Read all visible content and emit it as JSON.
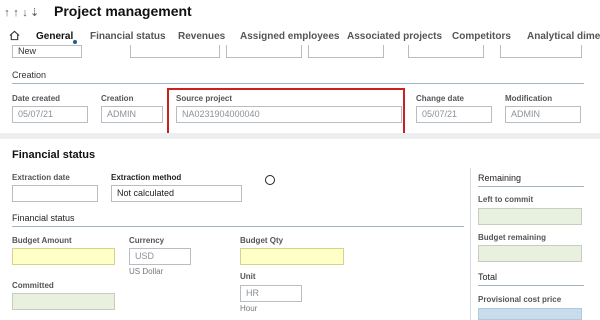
{
  "header": {
    "title": "Project management",
    "nav_arrows": [
      "↑",
      "↑",
      "↓",
      "⇣"
    ]
  },
  "tabs": [
    {
      "label": "General",
      "active": true
    },
    {
      "label": "Financial status"
    },
    {
      "label": "Revenues"
    },
    {
      "label": "Assigned employees"
    },
    {
      "label": "Associated projects"
    },
    {
      "label": "Competitors"
    },
    {
      "label": "Analytical dimen"
    }
  ],
  "top_row": {
    "status_value": "New"
  },
  "creation": {
    "section_label": "Creation",
    "date_created": {
      "label": "Date created",
      "value": "05/07/21"
    },
    "creation": {
      "label": "Creation",
      "value": "ADMIN"
    },
    "source_project": {
      "label": "Source project",
      "value": "NA0231904000040"
    },
    "change_date": {
      "label": "Change date",
      "value": "05/07/21"
    },
    "modification": {
      "label": "Modification",
      "value": "ADMIN"
    }
  },
  "financial": {
    "title": "Financial status",
    "extraction_date": {
      "label": "Extraction date",
      "value": ""
    },
    "extraction_method": {
      "label": "Extraction method",
      "value": "Not calculated"
    },
    "subsection": "Financial status",
    "budget_amount": {
      "label": "Budget Amount",
      "value": ""
    },
    "currency": {
      "label": "Currency",
      "value": "USD",
      "caption": "US Dollar"
    },
    "budget_qty": {
      "label": "Budget Qty",
      "value": ""
    },
    "unit": {
      "label": "Unit",
      "value": "HR",
      "caption": "Hour"
    },
    "committed": {
      "label": "Committed",
      "value": ""
    }
  },
  "remaining": {
    "title": "Remaining",
    "left_to_commit": {
      "label": "Left to commit",
      "value": ""
    },
    "budget_remaining": {
      "label": "Budget remaining",
      "value": ""
    },
    "total_title": "Total",
    "provisional_cost_price": {
      "label": "Provisional cost price",
      "value": ""
    }
  },
  "colors": {
    "highlight_border": "#cc1f1f",
    "mandatory_fill": "#ffffc8",
    "computed_fill": "#e8f0e0",
    "accent_fill": "#c7dcec"
  }
}
